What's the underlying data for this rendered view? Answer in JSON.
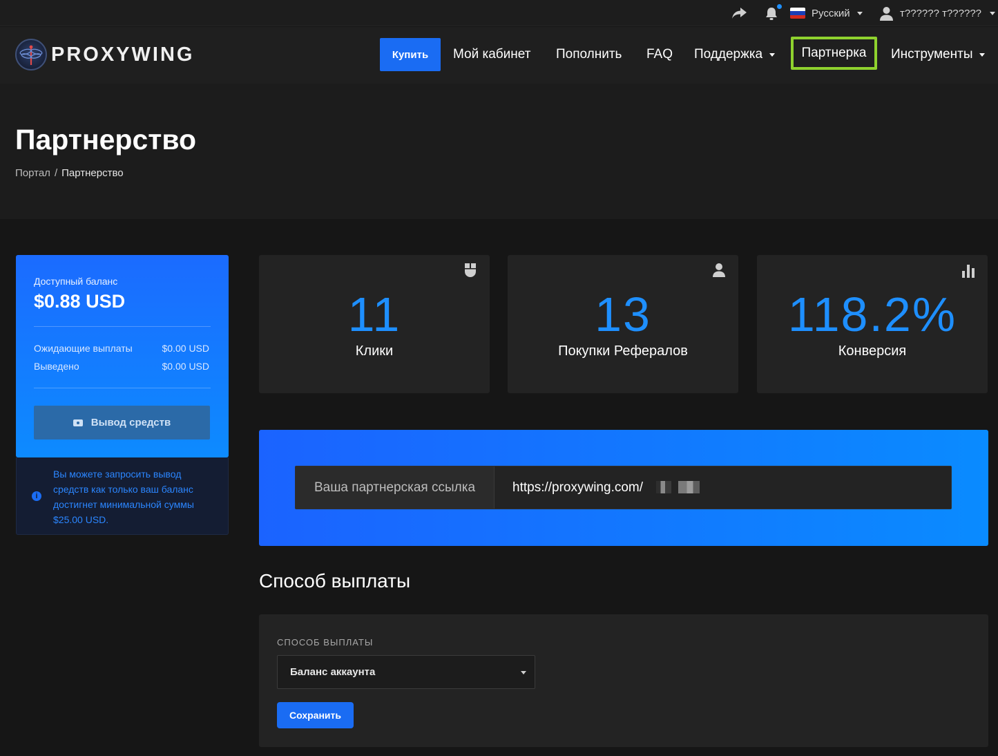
{
  "topbar": {
    "language": "Русский",
    "user": "т?????? т??????"
  },
  "nav": {
    "buy": "Купить",
    "cabinet": "Мой кабинет",
    "topup": "Пополнить",
    "faq": "FAQ",
    "support": "Поддержка",
    "partner": "Партнерка",
    "tools": "Инструменты"
  },
  "brand": {
    "name": "PROXYWING"
  },
  "header": {
    "title": "Партнерство",
    "breadcrumb": [
      "Портал",
      "/",
      "Партнерство"
    ]
  },
  "balance": {
    "label": "Доступный баланс",
    "value": "$0.88 USD",
    "pending_label": "Ожидающие выплаты",
    "pending_value": "$0.00 USD",
    "withdrawn_label": "Выведено",
    "withdrawn_value": "$0.00 USD",
    "withdraw_button": "Вывод средств",
    "info": "Вы можете запросить вывод средств как только ваш баланс достигнет минимальной суммы $25.00 USD."
  },
  "stats": [
    {
      "value": "11",
      "label": "Клики",
      "icon": "mouse-icon"
    },
    {
      "value": "13",
      "label": "Покупки Рефералов",
      "icon": "user-icon"
    },
    {
      "value": "118.2%",
      "label": "Конверсия",
      "icon": "bar-chart-icon"
    }
  ],
  "referral": {
    "label": "Ваша партнерская ссылка",
    "url": "https://proxywing.com/"
  },
  "payout": {
    "title": "Способ выплаты",
    "field_label": "СПОСОБ ВЫПЛАТЫ",
    "selected": "Баланс аккаунта",
    "save": "Сохранить"
  },
  "colors": {
    "accent": "#1a6cf3",
    "stat_number": "#1e8fff",
    "highlight": "#8fd22e",
    "background": "#161616"
  }
}
